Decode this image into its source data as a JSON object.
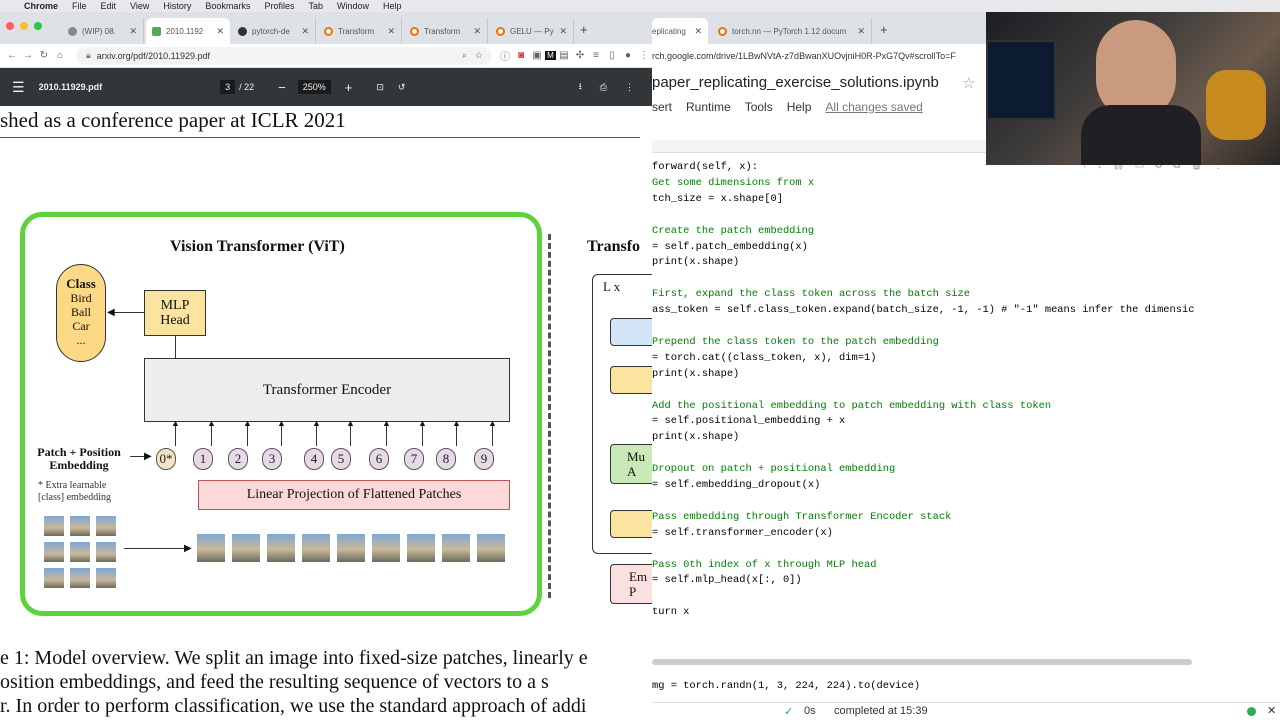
{
  "menubar": {
    "app": "Chrome",
    "items": [
      "File",
      "Edit",
      "View",
      "History",
      "Bookmarks",
      "Profiles",
      "Tab",
      "Window",
      "Help"
    ]
  },
  "left_window": {
    "tabs": [
      {
        "label": "(WIP) 08.",
        "color": "#888"
      },
      {
        "label": "2010.1192",
        "color": "#4caf50",
        "active": true
      },
      {
        "label": "pytorch-de",
        "color": "#333"
      },
      {
        "label": "Transform",
        "color": "#e8710a"
      },
      {
        "label": "Transform",
        "color": "#e8710a"
      },
      {
        "label": "GELU — Py",
        "color": "#e8710a"
      }
    ],
    "new_tab": "+",
    "url": "arxiv.org/pdf/2010.11929.pdf",
    "pdf": {
      "filename": "2010.11929.pdf",
      "page_current": "3",
      "page_total": "/ 22",
      "zoom": "250%",
      "header_text": "shed as a conference paper at ICLR 2021",
      "figure": {
        "vit_title": "Vision Transformer (ViT)",
        "class_box": {
          "title": "Class",
          "items": [
            "Bird",
            "Ball",
            "Car",
            "..."
          ]
        },
        "mlp_head": "MLP\nHead",
        "encoder": "Transformer Encoder",
        "patch_position": "Patch + Position\nEmbedding",
        "extra_note": "* Extra learnable\n[class] embedding",
        "linear_projection": "Linear Projection of Flattened Patches",
        "tokens": [
          "0*",
          "1",
          "2",
          "3",
          "4",
          "5",
          "6",
          "7",
          "8",
          "9"
        ],
        "encoder_title": "Transfo",
        "lx": "L x",
        "ma": "Mu\nA",
        "em": "Em\nP"
      },
      "caption_lines": [
        "e 1: Model overview. We split an image into fixed-size patches, linearly e",
        "osition embeddings, and feed the resulting sequence of vectors to a s",
        "r. In order to perform classification, we use the standard approach of addi"
      ]
    }
  },
  "right_window": {
    "tabs": [
      {
        "label": "eplicating",
        "color": "#f9ab00",
        "active": true
      },
      {
        "label": "torch.nn — PyTorch 1.12 docum",
        "color": "#e8710a"
      }
    ],
    "url": "rch.google.com/drive/1LBwNVtA-z7dBwanXUOvjniH0R-PxG7Qv#scrollTo=F",
    "notebook_title": "paper_replicating_exercise_solutions.ipynb",
    "menu": [
      "sert",
      "Runtime",
      "Tools",
      "Help"
    ],
    "saved_status": "All changes saved",
    "code_lines": [
      "forward(self, x):",
      "Get some dimensions from x",
      "tch_size = x.shape[0]",
      "",
      "Create the patch embedding",
      "= self.patch_embedding(x)",
      "print(x.shape)",
      "",
      "First, expand the class token across the batch size",
      "ass_token = self.class_token.expand(batch_size, -1, -1) # \"-1\" means infer the dimensic",
      "",
      "Prepend the class token to the patch embedding",
      "= torch.cat((class_token, x), dim=1)",
      "print(x.shape)",
      "",
      "Add the positional embedding to patch embedding with class token",
      "= self.positional_embedding + x",
      "print(x.shape)",
      "",
      "Dropout on patch + positional embedding",
      "= self.embedding_dropout(x)",
      "",
      "Pass embedding through Transformer Encoder stack",
      "= self.transformer_encoder(x)",
      "",
      "Pass 0th index of x through MLP head",
      "= self.mlp_head(x[:, 0])",
      "",
      "turn x"
    ],
    "next_cell": "mg = torch.randn(1, 3, 224, 224).to(device)",
    "status": {
      "check": "✓",
      "time": "0s",
      "completed": "completed at 15:39"
    }
  }
}
